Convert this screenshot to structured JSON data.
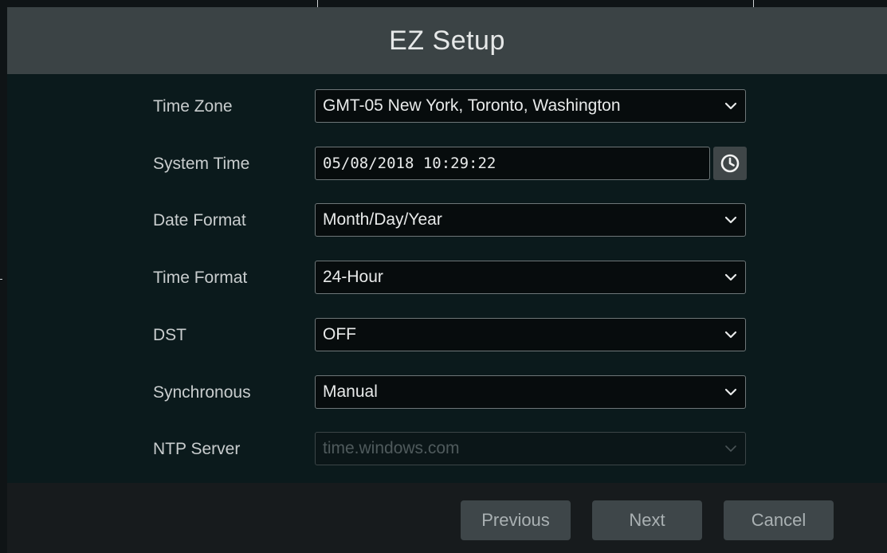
{
  "window": {
    "title": "EZ Setup"
  },
  "form": {
    "time_zone": {
      "label": "Time Zone",
      "value": "GMT-05 New York, Toronto, Washington"
    },
    "system_time": {
      "label": "System Time",
      "value": "05/08/2018 10:29:22"
    },
    "date_format": {
      "label": "Date Format",
      "value": "Month/Day/Year"
    },
    "time_format": {
      "label": "Time Format",
      "value": "24-Hour"
    },
    "dst": {
      "label": "DST",
      "value": "OFF"
    },
    "synchronous": {
      "label": "Synchronous",
      "value": "Manual"
    },
    "ntp_server": {
      "label": "NTP Server",
      "value": "time.windows.com",
      "disabled": true
    }
  },
  "footer": {
    "previous_label": "Previous",
    "next_label": "Next",
    "cancel_label": "Cancel"
  },
  "icons": {
    "dropdown": "chevron-down-icon",
    "clock": "clock-icon"
  },
  "colors": {
    "title_bar": "#3b4345",
    "panel_bg": "#0b1a1c",
    "footer_bg": "#171b1d",
    "button_bg": "#3e4649"
  }
}
